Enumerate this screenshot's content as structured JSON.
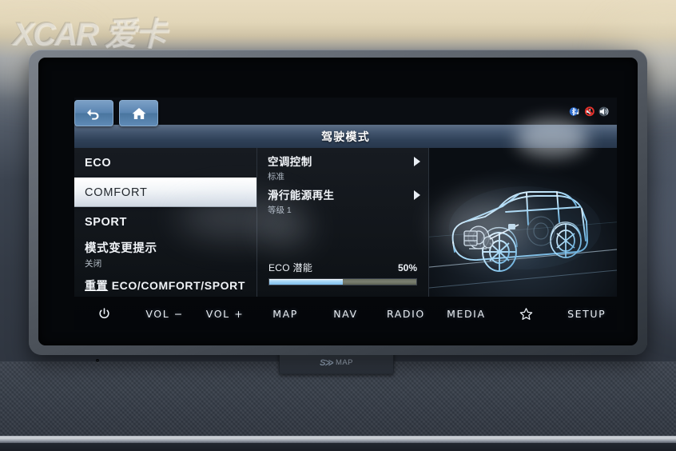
{
  "watermark": {
    "text": "XCAR 爱卡"
  },
  "head_unit": {
    "title": "驾驶模式",
    "nav_buttons": [
      {
        "name": "back",
        "icon": "back-arrow-icon"
      },
      {
        "name": "home",
        "icon": "home-icon"
      }
    ],
    "status_icons": [
      {
        "name": "bluetooth-audio-icon",
        "label": "Bluetooth Audio"
      },
      {
        "name": "mute-icon",
        "label": "Mute"
      },
      {
        "name": "sound-icon",
        "label": "Sound"
      }
    ],
    "drive_modes": [
      {
        "label": "ECO",
        "sub": "",
        "selected": false
      },
      {
        "label": "COMFORT",
        "sub": "",
        "selected": true
      },
      {
        "label": "SPORT",
        "sub": "",
        "selected": false
      }
    ],
    "mode_change_alert": {
      "label": "模式变更提示",
      "value": "关闭"
    },
    "reset": {
      "prefix": "重置",
      "targets": "ECO/COMFORT/SPORT"
    },
    "options": [
      {
        "title": "空调控制",
        "sub": "标准",
        "arrow": "chevron-right-icon"
      },
      {
        "title": "滑行能源再生",
        "sub": "等级 1",
        "arrow": "chevron-right-icon"
      }
    ],
    "eco_gauge": {
      "label": "ECO 潜能",
      "value_text": "50%",
      "value": 50,
      "fill_color": "#a6d5f5",
      "track_color": "#7b8071"
    },
    "illustration": {
      "name": "ev-powertrain-wireframe-car"
    },
    "hard_keys": [
      {
        "label": "",
        "icon": "power-icon"
      },
      {
        "label": "VOL −",
        "icon": ""
      },
      {
        "label": "VOL +",
        "icon": ""
      },
      {
        "label": "MAP",
        "icon": ""
      },
      {
        "label": "NAV",
        "icon": ""
      },
      {
        "label": "RADIO",
        "icon": ""
      },
      {
        "label": "MEDIA",
        "icon": ""
      },
      {
        "label": "",
        "icon": "star-icon"
      },
      {
        "label": "SETUP",
        "icon": ""
      }
    ]
  },
  "dashboard": {
    "sd_slot": {
      "logo": "S≫",
      "label": "MAP"
    }
  }
}
